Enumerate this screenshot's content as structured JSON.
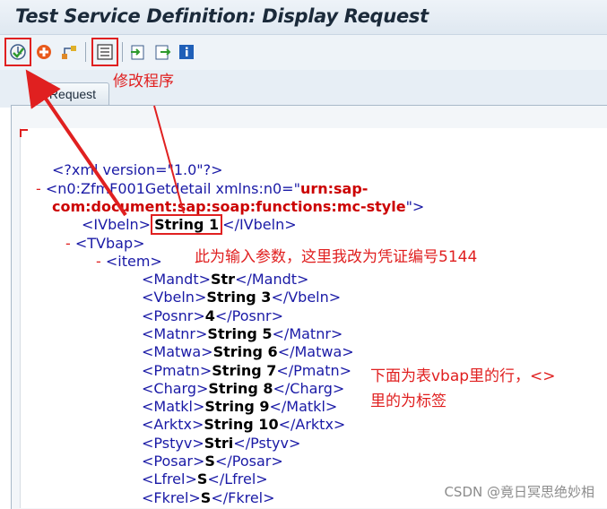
{
  "window": {
    "title": "Test Service Definition: Display Request"
  },
  "toolbar": {
    "buttons": [
      {
        "icon": "execute-check-icon"
      },
      {
        "icon": "stop-icon"
      },
      {
        "icon": "hierarchy-icon"
      },
      {
        "icon": "xml-editor-icon"
      },
      {
        "icon": "import-icon"
      },
      {
        "icon": "export-icon"
      },
      {
        "icon": "info-icon"
      }
    ]
  },
  "tabs": [
    {
      "label": "Request"
    }
  ],
  "annotations": {
    "modify_program": "修改程序",
    "input_param": "此为输入参数，这里我改为凭证编号5144",
    "rows_note_line1": "下面为表vbap里的行，<>",
    "rows_note_line2": "里的为标签"
  },
  "xml": {
    "decl": "<?xml version=\"1.0\"?>",
    "root_open": "<n0:ZfmF001Getdetail xmlns:n0=\"",
    "ns1": "urn:sap-",
    "ns2": "com:document:sap:soap:functions:mc-style",
    "ns_close": "\">",
    "ivbeln": {
      "open": "<IVbeln>",
      "value": "String 1",
      "close": "</IVbeln>"
    },
    "tvbap_open": "<TVbap>",
    "item_open": "<item>",
    "fields": [
      {
        "name": "Mandt",
        "value": "Str"
      },
      {
        "name": "Vbeln",
        "value": "String 3"
      },
      {
        "name": "Posnr",
        "value": "4"
      },
      {
        "name": "Matnr",
        "value": "String 5"
      },
      {
        "name": "Matwa",
        "value": "String 6"
      },
      {
        "name": "Pmatn",
        "value": "String 7"
      },
      {
        "name": "Charg",
        "value": "String 8"
      },
      {
        "name": "Matkl",
        "value": "String 9"
      },
      {
        "name": "Arktx",
        "value": "String 10"
      },
      {
        "name": "Pstyv",
        "value": "Stri"
      },
      {
        "name": "Posar",
        "value": "S"
      },
      {
        "name": "Lfrel",
        "value": "S"
      },
      {
        "name": "Fkrel",
        "value": "S"
      }
    ]
  },
  "watermark": "CSDN @竟日冥思绝妙相",
  "colors": {
    "tag": "#1a1aa6",
    "annotation": "#e02020",
    "ns": "#cc0000"
  }
}
